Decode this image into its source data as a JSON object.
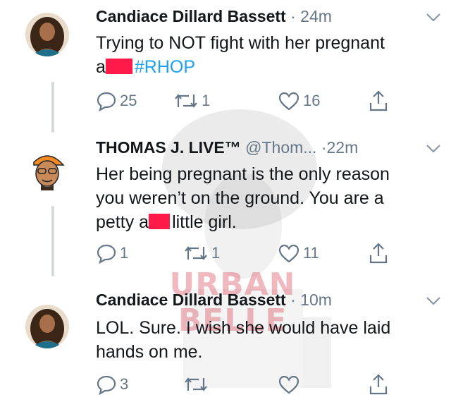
{
  "colors": {
    "accent": "#1da1f2",
    "muted": "#657786",
    "censor": "#ff1a4a",
    "line": "#d5dadf"
  },
  "watermark": {
    "text": "URBAN BELLE"
  },
  "tweets": [
    {
      "name": "Candiace Dillard Bassett",
      "handle": "",
      "separator": "·",
      "time": "24m",
      "text_start": "Trying to NOT fight with her pregnant",
      "text_line2_start": "a",
      "hashtag": "#RHOP",
      "text_end": "",
      "reply_count": "25",
      "retweet_count": "1",
      "like_count": "16",
      "icons": [
        "reply-icon",
        "retweet-icon",
        "like-icon",
        "share-icon"
      ]
    },
    {
      "name": "THOMAS J. LIVE™",
      "handle": "@Thom...",
      "separator": "·",
      "time": "22m",
      "line1": "Her being pregnant is the only reason",
      "line2": "you weren’t on the ground. You are a",
      "line3_start": "petty a",
      "line3_end": "little girl.",
      "reply_count": "1",
      "retweet_count": "1",
      "like_count": "11"
    },
    {
      "name": "Candiace Dillard Bassett",
      "handle": "",
      "separator": "·",
      "time": "10m",
      "line1": "LOL. Sure. I wish she would have laid",
      "line2": "hands on me.",
      "reply_count": "3",
      "retweet_count": "",
      "like_count": ""
    }
  ]
}
